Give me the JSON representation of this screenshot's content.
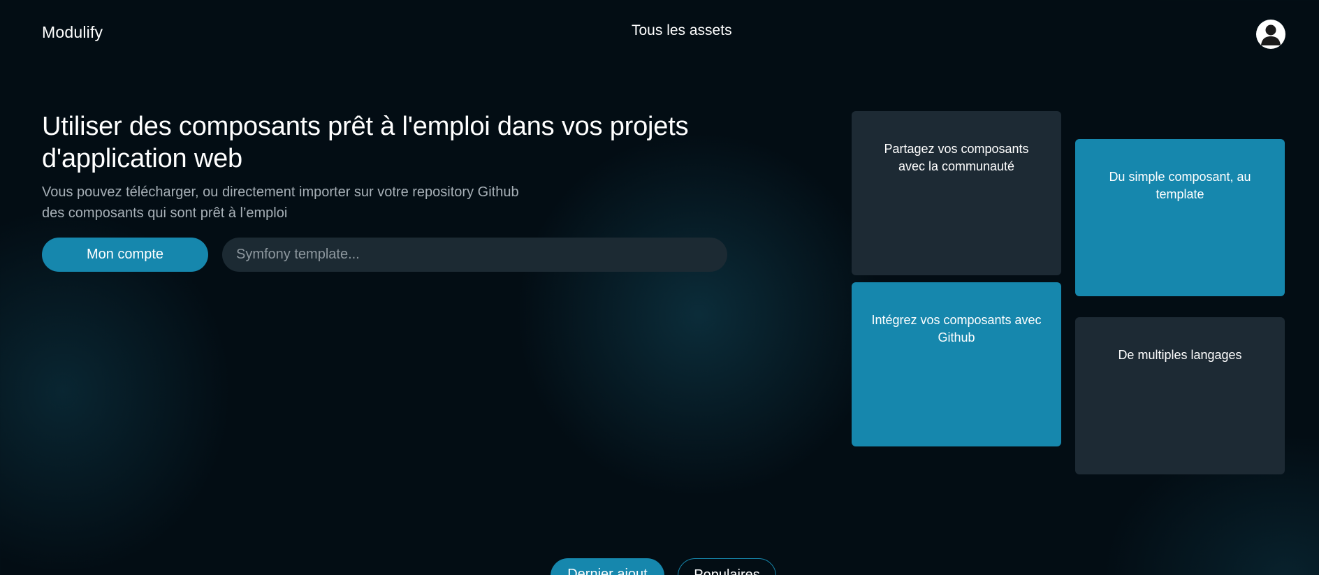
{
  "header": {
    "logo": "Modulify",
    "nav_link": "Tous les assets",
    "avatar_icon": "user-avatar-icon"
  },
  "hero": {
    "title": "Utiliser des composants prêt à l'emploi dans vos projets d'application web",
    "subtitle_line1": "Vous pouvez télécharger, ou directement importer sur votre repository Github",
    "subtitle_line2": "des composants qui sont prêt à l’emploi",
    "account_button": "Mon compte",
    "search_placeholder": "Symfony template..."
  },
  "features": {
    "cards": [
      {
        "text": "Partagez vos composants avec la communauté",
        "style": "dark"
      },
      {
        "text": "Du simple composant, au template",
        "style": "blue"
      },
      {
        "text": "Intégrez vos composants avec Github",
        "style": "blue"
      },
      {
        "text": "De multiples langages",
        "style": "dark"
      }
    ]
  },
  "tabs": [
    {
      "label": "Dernier ajout",
      "active": true
    },
    {
      "label": "Populaires",
      "active": false
    }
  ],
  "colors": {
    "background": "#030d14",
    "accent": "#1687ad",
    "card_dark": "#1d2a34",
    "input_bg": "#1c2a33",
    "subtitle_text": "#a7b0b7"
  }
}
